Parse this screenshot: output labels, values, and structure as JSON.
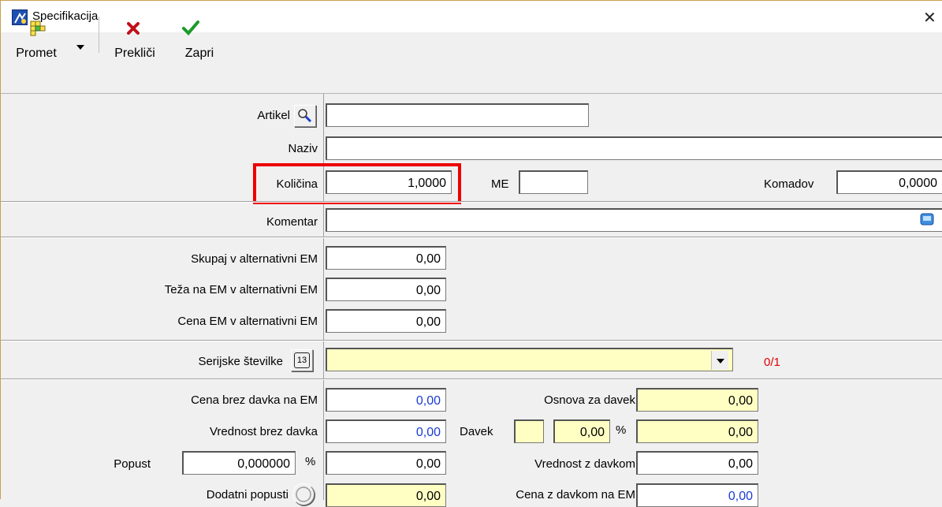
{
  "window": {
    "title": "Specifikacija",
    "close_glyph": "✕"
  },
  "toolbar": {
    "promet_label": "Promet",
    "preklici_label": "Prekliči",
    "zapri_label": "Zapri"
  },
  "form": {
    "artikel": {
      "label": "Artikel",
      "value": ""
    },
    "naziv": {
      "label": "Naziv",
      "value": ""
    },
    "kolicina": {
      "label": "Količina",
      "value": "1,0000"
    },
    "me": {
      "label": "ME",
      "value": ""
    },
    "komadov": {
      "label": "Komadov",
      "value": "0,0000"
    },
    "komentar": {
      "label": "Komentar",
      "value": ""
    },
    "skupaj_alt": {
      "label": "Skupaj v alternativni EM",
      "value": "0,00"
    },
    "teza_alt": {
      "label": "Teža na EM v alternativni EM",
      "value": "0,00"
    },
    "cena_alt": {
      "label": "Cena EM v alternativni EM",
      "value": "0,00"
    },
    "serijske": {
      "label": "Serijske številke",
      "value": "",
      "count": "0/1",
      "icon_text": "13"
    },
    "cena_brez_davka": {
      "label": "Cena brez davka na EM",
      "value": "0,00"
    },
    "vrednost_brez_davka": {
      "label": "Vrednost brez davka",
      "value": "0,00"
    },
    "popust": {
      "label": "Popust",
      "value": "0,000000",
      "unit": "%",
      "amount": "0,00"
    },
    "dodatni_popusti": {
      "label": "Dodatni popusti",
      "value": "0,00"
    },
    "osnova_za_davek": {
      "label": "Osnova za davek",
      "value": "0,00"
    },
    "davek": {
      "label": "Davek",
      "code": "",
      "rate": "0,00",
      "unit": "%",
      "value": "0,00"
    },
    "vrednost_z_davkom": {
      "label": "Vrednost z davkom",
      "value": "0,00"
    },
    "cena_z_davkom": {
      "label": "Cena z davkom na EM",
      "value": "0,00"
    }
  },
  "colors": {
    "highlight": "#ee0000",
    "yellow_field": "#ffffc4",
    "blue_value": "#1a3cd0"
  }
}
